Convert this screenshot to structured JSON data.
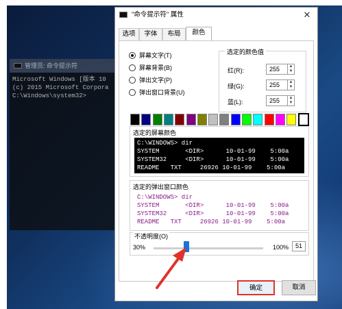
{
  "console": {
    "title": "管理员: 命令提示符",
    "lines": [
      "Microsoft Windows [版本 10",
      "(c) 2015 Microsoft Corpora",
      "",
      "C:\\Windows\\system32>"
    ]
  },
  "dialog": {
    "title": "\"命令提示符\" 属性",
    "close_label": "✕",
    "tabs": [
      "选项",
      "字体",
      "布局",
      "颜色"
    ],
    "active_tab": "颜色",
    "radio_options": [
      {
        "label": "屏幕文字(T)",
        "checked": true
      },
      {
        "label": "屏幕背景(B)",
        "checked": false
      },
      {
        "label": "弹出文字(P)",
        "checked": false
      },
      {
        "label": "弹出窗口背景(U)",
        "checked": false
      }
    ],
    "selected_color": {
      "legend": "选定的颜色值",
      "rows": [
        {
          "label": "红(R):",
          "value": "255"
        },
        {
          "label": "绿(G):",
          "value": "255"
        },
        {
          "label": "蓝(L):",
          "value": "255"
        }
      ]
    },
    "palette": [
      "#000000",
      "#000080",
      "#008000",
      "#008080",
      "#800000",
      "#800080",
      "#808000",
      "#c0c0c0",
      "#808080",
      "#0000ff",
      "#00ff00",
      "#00ffff",
      "#ff0000",
      "#ff00ff",
      "#ffff00",
      "#ffffff"
    ],
    "selected_swatch_index": 15,
    "screen_preview": {
      "label": "选定的屏幕颜色",
      "text": "C:\\WINDOWS> dir\nSYSTEM       <DIR>      10-01-99    5:00a\nSYSTEM32     <DIR>      10-01-99    5:00a\nREADME   TXT     26926 10-01-99    5:00a"
    },
    "popup_preview": {
      "label": "选定的弹出窗口颜色",
      "text": "C:\\WINDOWS> dir\nSYSTEM       <DIR>      10-01-99    5:00a\nSYSTEM32     <DIR>      10-01-99    5:00a\nREADME   TXT     26926 10-01-99    5:00a"
    },
    "opacity": {
      "label": "不透明度(O)",
      "min_label": "30%",
      "max_label": "100%",
      "value": "51",
      "level_fraction": 0.3
    },
    "ok_label": "确定",
    "cancel_label": "取消"
  },
  "colors": {
    "accent_blue": "#1a73d6",
    "annotation_red": "#e0322a",
    "popup_text": "#8a1a8a"
  }
}
